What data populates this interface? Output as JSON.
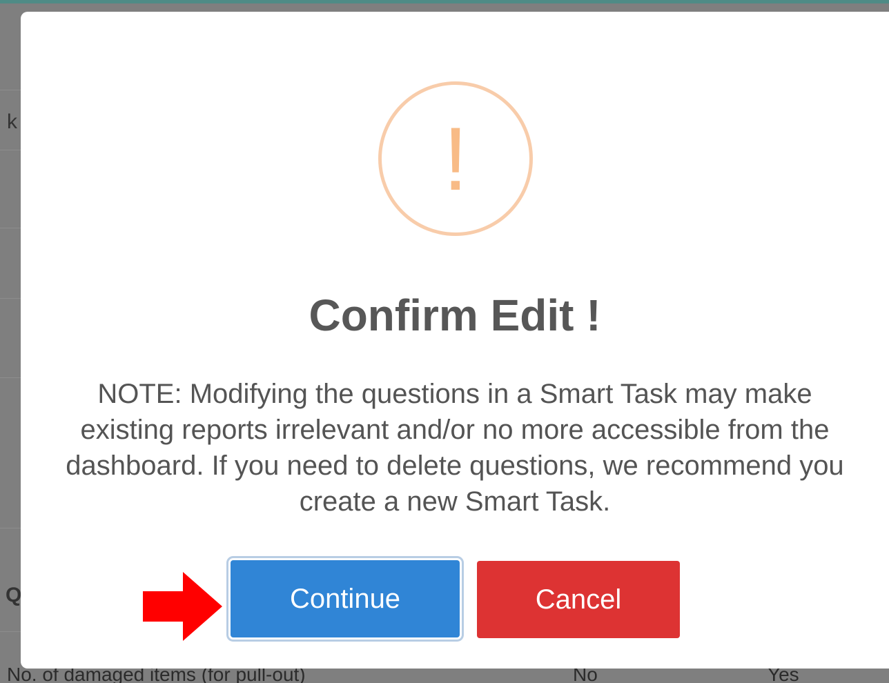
{
  "background": {
    "fragment_left_top": "k",
    "fragment_left_bottom": "Q",
    "bottom_row": {
      "label": "No. of damaged items (for pull-out)",
      "col1": "No",
      "col2": "Yes"
    }
  },
  "dialog": {
    "icon": "warning-exclamation-icon",
    "icon_glyph": "!",
    "title": "Confirm Edit !",
    "message": "NOTE: Modifying the questions in a Smart Task may make existing reports irrelevant and/or no more accessible from the dashboard. If you need to delete questions, we recommend you create a new Smart Task.",
    "buttons": {
      "continue_label": "Continue",
      "cancel_label": "Cancel"
    }
  },
  "annotation": {
    "icon": "red-arrow-icon"
  },
  "colors": {
    "overlay": "#7f7f7f",
    "warning": "#f8bb86",
    "continue": "#3085d6",
    "cancel": "#dd3333",
    "arrow": "#ff0000",
    "title_text": "#575757"
  }
}
